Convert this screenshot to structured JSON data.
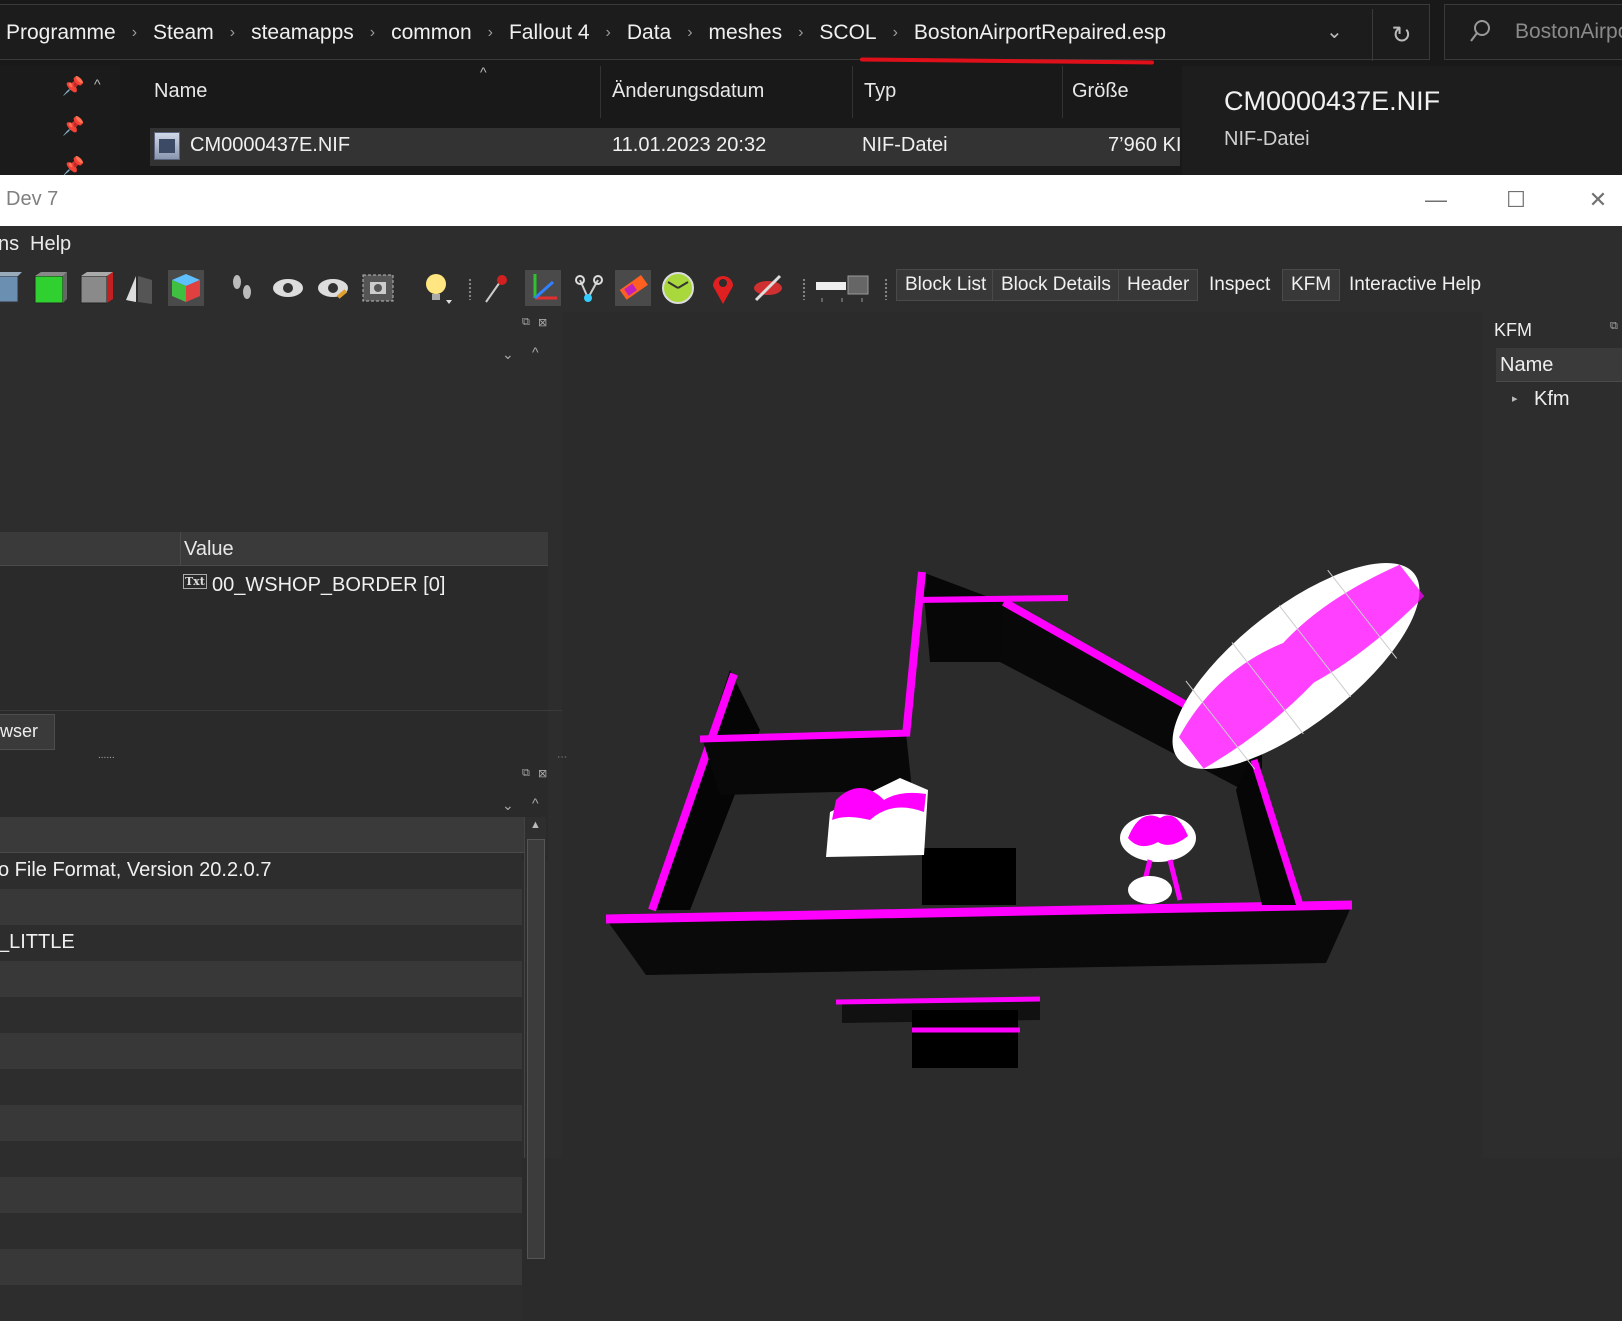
{
  "explorer": {
    "breadcrumb": [
      "Programme",
      "Steam",
      "steamapps",
      "common",
      "Fallout 4",
      "Data",
      "meshes",
      "SCOL",
      "BostonAirportRepaired.esp"
    ],
    "search_text": "BostonAirpo",
    "columns": {
      "name": "Name",
      "date": "Änderungsdatum",
      "type": "Typ",
      "size": "Größe"
    },
    "file": {
      "name": "CM0000437E.NIF",
      "date": "11.01.2023 20:32",
      "type": "NIF-Datei",
      "size": "7’960 KI"
    },
    "preview": {
      "title": "CM0000437E.NIF",
      "type": "NIF-Datei"
    },
    "accent_color": "#e0101a"
  },
  "nifskope": {
    "title": "Dev 7",
    "menu": {
      "partial": "ns",
      "help": "Help"
    },
    "toolbar_buttons": {
      "block_list": "Block List",
      "block_details": "Block Details",
      "header": "Header",
      "inspect": "Inspect",
      "kfm": "KFM",
      "interactive_help": "Interactive Help"
    },
    "block_details": {
      "value_header": "Value",
      "value": "00_WSHOP_BORDER [0]",
      "badge": "Txt"
    },
    "tab_label": "wser",
    "header_panel": {
      "rows": [
        "o File Format, Version 20.2.0.7",
        "",
        "_LITTLE",
        "",
        "",
        "",
        "",
        "",
        "",
        "",
        "",
        "",
        ""
      ]
    },
    "kfm_panel": {
      "title": "KFM",
      "column": "Name",
      "item": "Kfm"
    },
    "model_color": "#ff00ff"
  }
}
